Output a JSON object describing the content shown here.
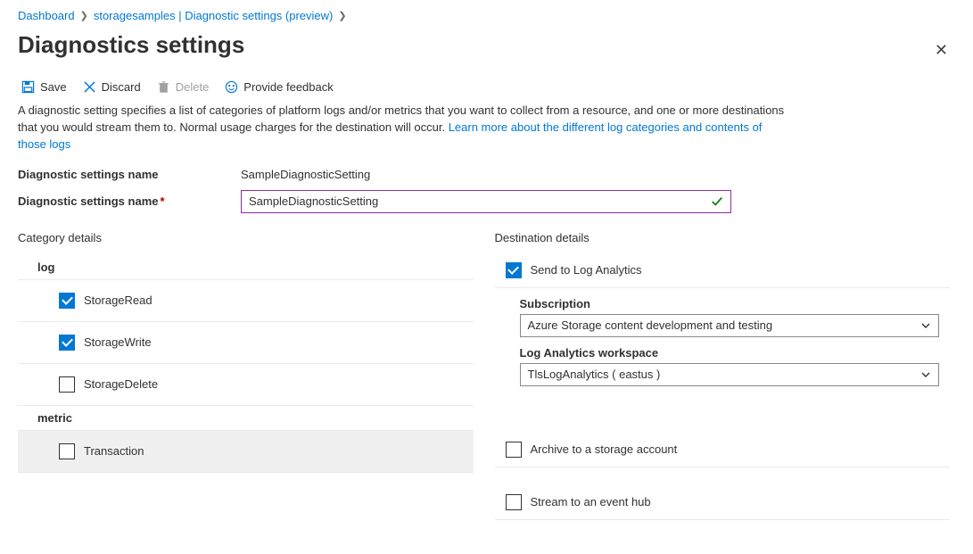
{
  "breadcrumb": {
    "items": [
      "Dashboard",
      "storagesamples | Diagnostic settings (preview)"
    ]
  },
  "title": "Diagnostics settings",
  "toolbar": {
    "save": "Save",
    "discard": "Discard",
    "delete": "Delete",
    "feedback": "Provide feedback"
  },
  "description": {
    "text": "A diagnostic setting specifies a list of categories of platform logs and/or metrics that you want to collect from a resource, and one or more destinations that you would stream them to. Normal usage charges for the destination will occur. ",
    "link": "Learn more about the different log categories and contents of those logs"
  },
  "name_label": "Diagnostic settings name",
  "name_value": "SampleDiagnosticSetting",
  "name_input_label": "Diagnostic settings name",
  "name_input_value": "SampleDiagnosticSetting",
  "category": {
    "header": "Category details",
    "log_group": "log",
    "logs": [
      {
        "label": "StorageRead",
        "checked": true
      },
      {
        "label": "StorageWrite",
        "checked": true
      },
      {
        "label": "StorageDelete",
        "checked": false
      }
    ],
    "metric_group": "metric",
    "metrics": [
      {
        "label": "Transaction",
        "checked": false
      }
    ]
  },
  "destination": {
    "header": "Destination details",
    "log_analytics": {
      "label": "Send to Log Analytics",
      "checked": true
    },
    "subscription": {
      "label": "Subscription",
      "value": "Azure Storage content development and testing"
    },
    "workspace": {
      "label": "Log Analytics workspace",
      "value": "TlsLogAnalytics ( eastus )"
    },
    "archive": {
      "label": "Archive to a storage account",
      "checked": false
    },
    "stream": {
      "label": "Stream to an event hub",
      "checked": false
    }
  }
}
